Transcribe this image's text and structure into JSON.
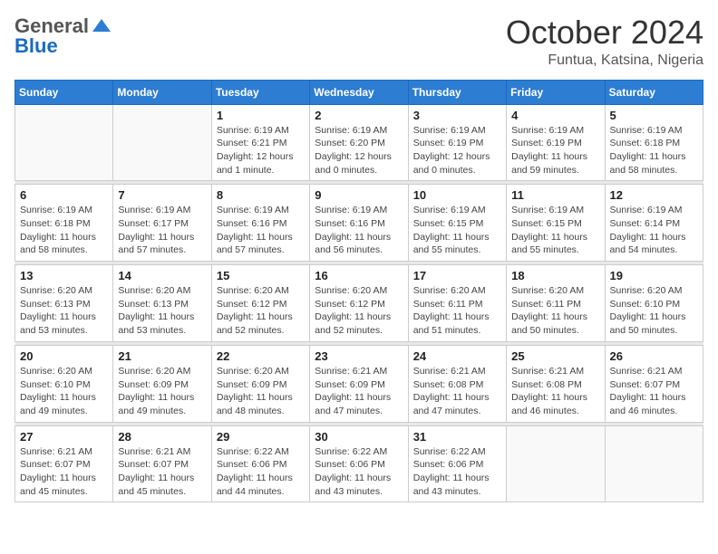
{
  "header": {
    "logo_general": "General",
    "logo_blue": "Blue",
    "month_title": "October 2024",
    "location": "Funtua, Katsina, Nigeria"
  },
  "weekdays": [
    "Sunday",
    "Monday",
    "Tuesday",
    "Wednesday",
    "Thursday",
    "Friday",
    "Saturday"
  ],
  "weeks": [
    [
      {
        "day": "",
        "info": ""
      },
      {
        "day": "",
        "info": ""
      },
      {
        "day": "1",
        "info": "Sunrise: 6:19 AM\nSunset: 6:21 PM\nDaylight: 12 hours and 1 minute."
      },
      {
        "day": "2",
        "info": "Sunrise: 6:19 AM\nSunset: 6:20 PM\nDaylight: 12 hours and 0 minutes."
      },
      {
        "day": "3",
        "info": "Sunrise: 6:19 AM\nSunset: 6:19 PM\nDaylight: 12 hours and 0 minutes."
      },
      {
        "day": "4",
        "info": "Sunrise: 6:19 AM\nSunset: 6:19 PM\nDaylight: 11 hours and 59 minutes."
      },
      {
        "day": "5",
        "info": "Sunrise: 6:19 AM\nSunset: 6:18 PM\nDaylight: 11 hours and 58 minutes."
      }
    ],
    [
      {
        "day": "6",
        "info": "Sunrise: 6:19 AM\nSunset: 6:18 PM\nDaylight: 11 hours and 58 minutes."
      },
      {
        "day": "7",
        "info": "Sunrise: 6:19 AM\nSunset: 6:17 PM\nDaylight: 11 hours and 57 minutes."
      },
      {
        "day": "8",
        "info": "Sunrise: 6:19 AM\nSunset: 6:16 PM\nDaylight: 11 hours and 57 minutes."
      },
      {
        "day": "9",
        "info": "Sunrise: 6:19 AM\nSunset: 6:16 PM\nDaylight: 11 hours and 56 minutes."
      },
      {
        "day": "10",
        "info": "Sunrise: 6:19 AM\nSunset: 6:15 PM\nDaylight: 11 hours and 55 minutes."
      },
      {
        "day": "11",
        "info": "Sunrise: 6:19 AM\nSunset: 6:15 PM\nDaylight: 11 hours and 55 minutes."
      },
      {
        "day": "12",
        "info": "Sunrise: 6:19 AM\nSunset: 6:14 PM\nDaylight: 11 hours and 54 minutes."
      }
    ],
    [
      {
        "day": "13",
        "info": "Sunrise: 6:20 AM\nSunset: 6:13 PM\nDaylight: 11 hours and 53 minutes."
      },
      {
        "day": "14",
        "info": "Sunrise: 6:20 AM\nSunset: 6:13 PM\nDaylight: 11 hours and 53 minutes."
      },
      {
        "day": "15",
        "info": "Sunrise: 6:20 AM\nSunset: 6:12 PM\nDaylight: 11 hours and 52 minutes."
      },
      {
        "day": "16",
        "info": "Sunrise: 6:20 AM\nSunset: 6:12 PM\nDaylight: 11 hours and 52 minutes."
      },
      {
        "day": "17",
        "info": "Sunrise: 6:20 AM\nSunset: 6:11 PM\nDaylight: 11 hours and 51 minutes."
      },
      {
        "day": "18",
        "info": "Sunrise: 6:20 AM\nSunset: 6:11 PM\nDaylight: 11 hours and 50 minutes."
      },
      {
        "day": "19",
        "info": "Sunrise: 6:20 AM\nSunset: 6:10 PM\nDaylight: 11 hours and 50 minutes."
      }
    ],
    [
      {
        "day": "20",
        "info": "Sunrise: 6:20 AM\nSunset: 6:10 PM\nDaylight: 11 hours and 49 minutes."
      },
      {
        "day": "21",
        "info": "Sunrise: 6:20 AM\nSunset: 6:09 PM\nDaylight: 11 hours and 49 minutes."
      },
      {
        "day": "22",
        "info": "Sunrise: 6:20 AM\nSunset: 6:09 PM\nDaylight: 11 hours and 48 minutes."
      },
      {
        "day": "23",
        "info": "Sunrise: 6:21 AM\nSunset: 6:09 PM\nDaylight: 11 hours and 47 minutes."
      },
      {
        "day": "24",
        "info": "Sunrise: 6:21 AM\nSunset: 6:08 PM\nDaylight: 11 hours and 47 minutes."
      },
      {
        "day": "25",
        "info": "Sunrise: 6:21 AM\nSunset: 6:08 PM\nDaylight: 11 hours and 46 minutes."
      },
      {
        "day": "26",
        "info": "Sunrise: 6:21 AM\nSunset: 6:07 PM\nDaylight: 11 hours and 46 minutes."
      }
    ],
    [
      {
        "day": "27",
        "info": "Sunrise: 6:21 AM\nSunset: 6:07 PM\nDaylight: 11 hours and 45 minutes."
      },
      {
        "day": "28",
        "info": "Sunrise: 6:21 AM\nSunset: 6:07 PM\nDaylight: 11 hours and 45 minutes."
      },
      {
        "day": "29",
        "info": "Sunrise: 6:22 AM\nSunset: 6:06 PM\nDaylight: 11 hours and 44 minutes."
      },
      {
        "day": "30",
        "info": "Sunrise: 6:22 AM\nSunset: 6:06 PM\nDaylight: 11 hours and 43 minutes."
      },
      {
        "day": "31",
        "info": "Sunrise: 6:22 AM\nSunset: 6:06 PM\nDaylight: 11 hours and 43 minutes."
      },
      {
        "day": "",
        "info": ""
      },
      {
        "day": "",
        "info": ""
      }
    ]
  ]
}
